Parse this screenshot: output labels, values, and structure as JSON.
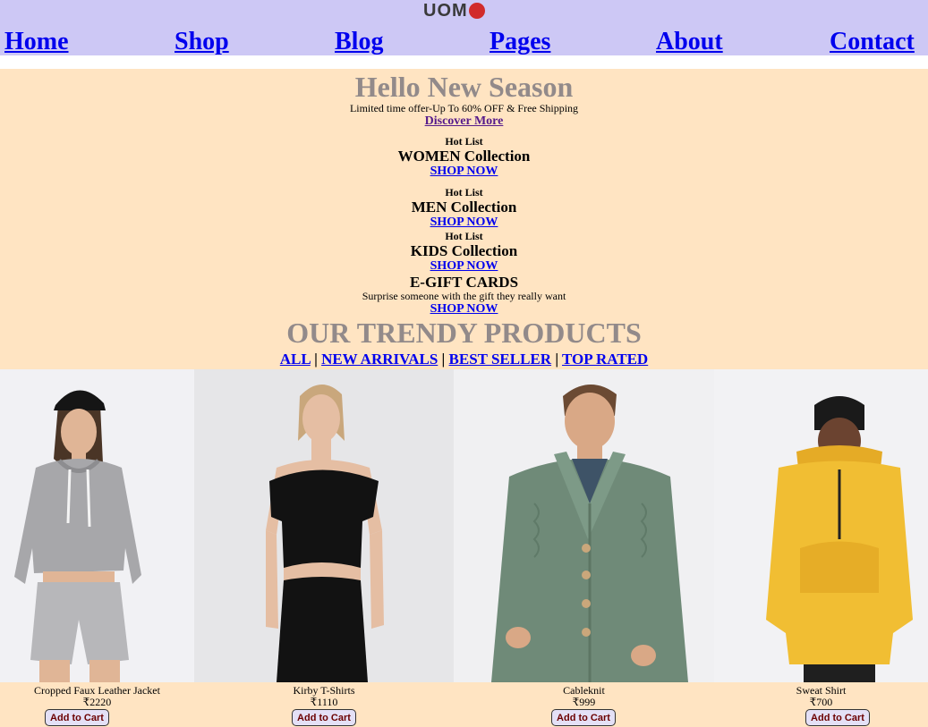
{
  "brand": {
    "logo_text": "UOM",
    "logo_dot_color": "#d12b2b"
  },
  "nav": {
    "home": "Home",
    "shop": "Shop",
    "blog": "Blog",
    "pages": "Pages",
    "about": "About",
    "contact": "Contact"
  },
  "hero": {
    "title": "Hello New Season",
    "subtitle": "Limited time offer-Up To 60% OFF & Free Shipping",
    "cta": "Discover More"
  },
  "collections": [
    {
      "tag": "Hot List",
      "title": "WOMEN Collection",
      "cta": "SHOP NOW"
    },
    {
      "tag": "Hot List",
      "title": "MEN Collection",
      "cta": "SHOP NOW"
    },
    {
      "tag": "Hot List",
      "title": "KIDS Collection",
      "cta": "SHOP NOW"
    }
  ],
  "gift": {
    "title": "E-GIFT CARDS",
    "subtitle": "Surprise someone with the gift they really want",
    "cta": "SHOP NOW"
  },
  "trendy": {
    "title": "OUR TRENDY PRODUCTS",
    "filters": [
      "ALL",
      "NEW ARRIVALS",
      "BEST SELLER",
      "TOP RATED"
    ],
    "separator": "|"
  },
  "products": [
    {
      "name": "Cropped Faux Leather Jacket",
      "price": "₹2220",
      "cta": "Add to Cart"
    },
    {
      "name": "Kirby T-Shirts",
      "price": "₹1110",
      "cta": "Add to Cart"
    },
    {
      "name": "Cableknit",
      "price": "₹999",
      "cta": "Add to Cart"
    },
    {
      "name": "Sweat Shirt",
      "price": "₹700",
      "cta": "Add to Cart"
    }
  ],
  "colors": {
    "topbar": "#cdc8f5",
    "hero_bg": "#ffe4c2",
    "heading_gray": "#928a8a",
    "link": "#0000ee",
    "visited_link": "#551a8b",
    "button_bg": "#e4e0f6",
    "button_text": "#6b0000"
  }
}
